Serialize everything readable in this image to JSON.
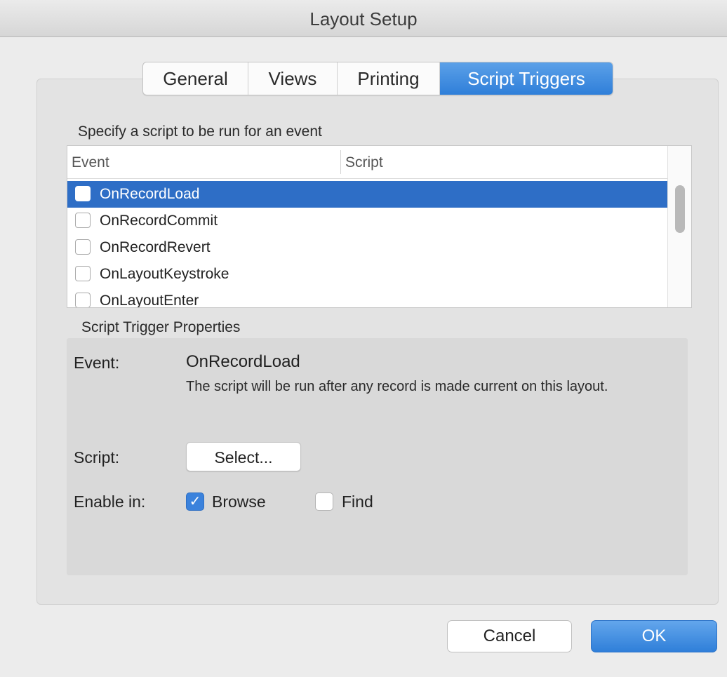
{
  "window": {
    "title": "Layout Setup"
  },
  "tabs": [
    {
      "label": "General"
    },
    {
      "label": "Views"
    },
    {
      "label": "Printing"
    },
    {
      "label": "Script Triggers",
      "selected": true
    }
  ],
  "events_section": {
    "heading": "Specify a script to be run for an event",
    "columns": {
      "event": "Event",
      "script": "Script"
    },
    "rows": [
      {
        "event": "OnRecordLoad",
        "script": "",
        "checked": false,
        "selected": true
      },
      {
        "event": "OnRecordCommit",
        "script": "",
        "checked": false,
        "selected": false
      },
      {
        "event": "OnRecordRevert",
        "script": "",
        "checked": false,
        "selected": false
      },
      {
        "event": "OnLayoutKeystroke",
        "script": "",
        "checked": false,
        "selected": false
      },
      {
        "event": "OnLayoutEnter",
        "script": "",
        "checked": false,
        "selected": false
      }
    ]
  },
  "properties": {
    "heading": "Script Trigger Properties",
    "event_label": "Event:",
    "event_value": "OnRecordLoad",
    "event_description": "The script will be run after any record is made current on this layout.",
    "script_label": "Script:",
    "select_button": "Select...",
    "enable_label": "Enable in:",
    "browse": {
      "label": "Browse",
      "checked": true
    },
    "find": {
      "label": "Find",
      "checked": false
    }
  },
  "buttons": {
    "cancel": "Cancel",
    "ok": "OK"
  },
  "colors": {
    "accent": "#2f7fd9",
    "selection": "#2e6ec6"
  }
}
